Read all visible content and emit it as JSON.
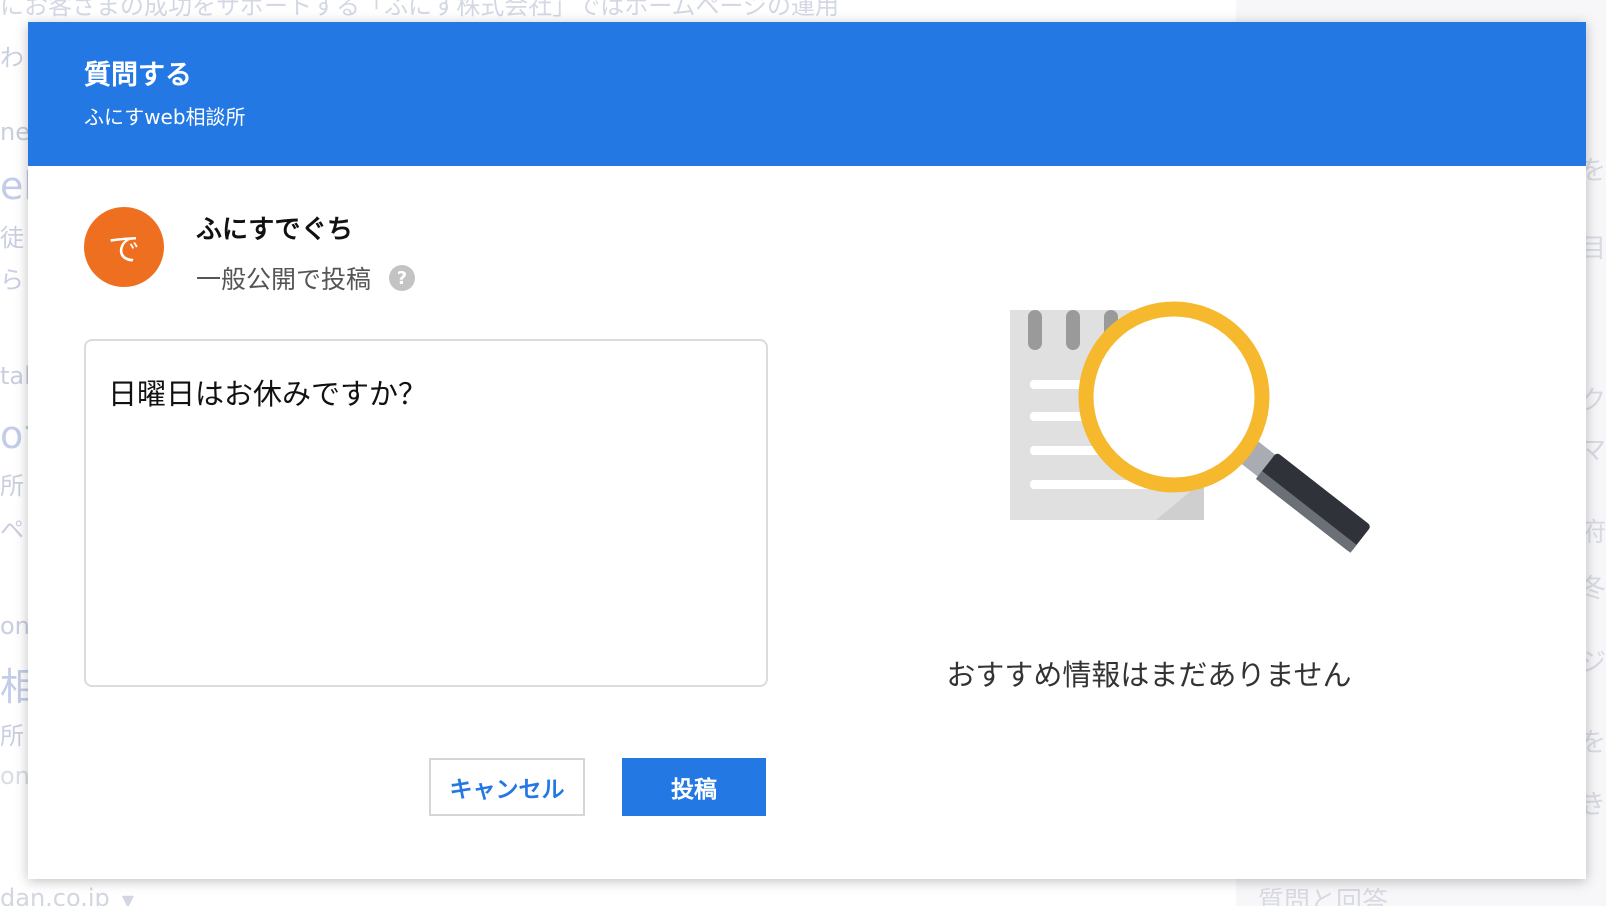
{
  "background": {
    "top_text": "にお客さまの成功をサポートする「ふにす株式会社」ではホームページの運用",
    "fragments": [
      "わ",
      "ne",
      "eb",
      "徒",
      "ら",
      "tal",
      "oサ",
      "所",
      "ペ",
      "on",
      "相",
      "所",
      "one"
    ],
    "right_fragments": [
      "を",
      "目",
      "ク",
      "マ",
      "府",
      "冬",
      "ジ",
      "を",
      "き"
    ],
    "footer_text": "dan.co.jp",
    "footer_right": "質問と回答"
  },
  "dialog": {
    "title": "質問する",
    "subtitle": "ふにすweb相談所"
  },
  "user": {
    "avatar_char": "で",
    "name": "ふにすでぐち",
    "visibility": "一般公開で投稿",
    "help_icon": "?"
  },
  "question": {
    "value": "日曜日はお休みですか？"
  },
  "buttons": {
    "cancel": "キャンセル",
    "post": "投稿"
  },
  "recommendations": {
    "empty_message": "おすすめ情報はまだありません"
  },
  "colors": {
    "header": "#2478e4",
    "avatar": "#ef6f20",
    "magnifier_ring": "#f6b92e"
  }
}
